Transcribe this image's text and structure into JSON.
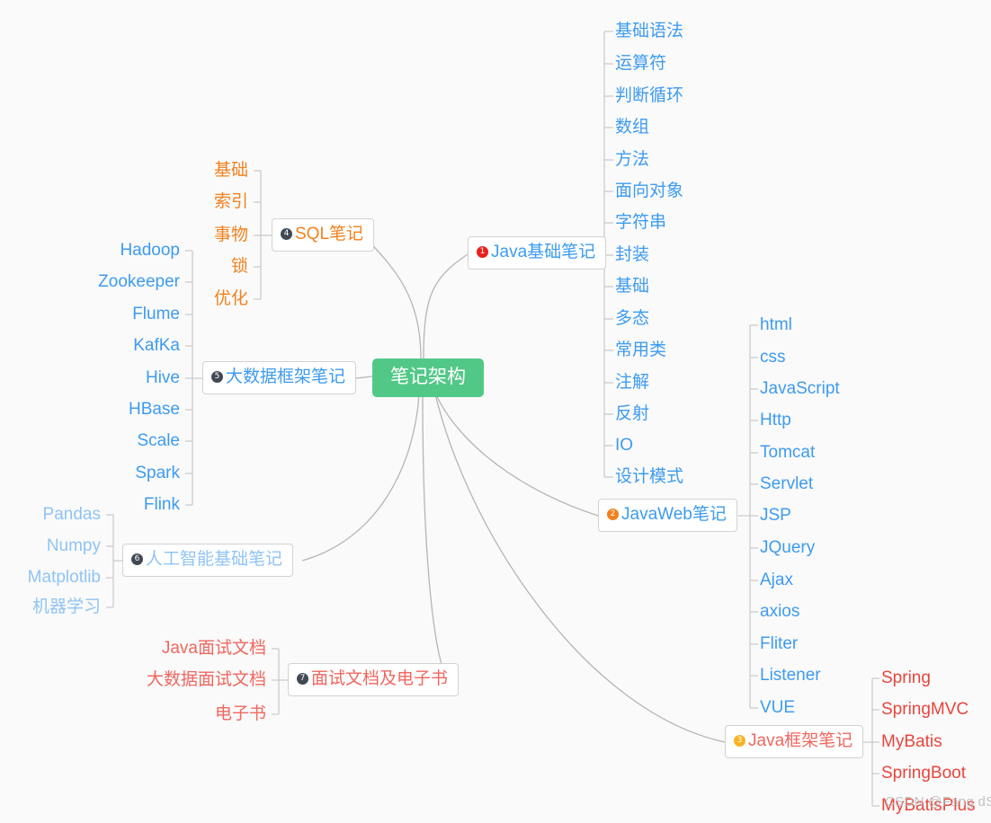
{
  "root": {
    "label": "笔记架构",
    "color": "#52c887"
  },
  "watermark": "CSDN @Fang dS",
  "colors": {
    "blue": "#3d9bf0",
    "blue_light": "#8fc4f5",
    "orange": "#f2811d",
    "red": "#e8453c",
    "salmon": "#f0675f",
    "badge_dark": "#414a54",
    "badge_red": "#e8201c",
    "badge_orange": "#f2811d",
    "badge_yellow": "#f5b324",
    "link": "#b5b5b5"
  },
  "branches": [
    {
      "id": "java-basic",
      "badge": "1",
      "badge_color": "#e8201c",
      "label": "Java基础笔记",
      "text_color": "#3d9bf0",
      "children": [
        "基础语法",
        "运算符",
        "判断循环",
        "数组",
        "方法",
        "面向对象",
        "字符串",
        "封装",
        "基础",
        "多态",
        "常用类",
        "注解",
        "反射",
        "IO",
        "设计模式"
      ],
      "children_color": "#3d9bf0"
    },
    {
      "id": "javaweb",
      "badge": "2",
      "badge_color": "#f2811d",
      "label": "JavaWeb笔记",
      "text_color": "#3d9bf0",
      "children": [
        "html",
        "css",
        "JavaScript",
        "Http",
        "Tomcat",
        "Servlet",
        "JSP",
        "JQuery",
        "Ajax",
        "axios",
        "Fliter",
        "Listener",
        "VUE"
      ],
      "children_color": "#3d9bf0"
    },
    {
      "id": "java-frame",
      "badge": "3",
      "badge_color": "#f5b324",
      "label": "Java框架笔记",
      "text_color": "#f0675f",
      "children": [
        "Spring",
        "SpringMVC",
        "MyBatis",
        "SpringBoot",
        "MyBatisPlus"
      ],
      "children_color": "#e8453c"
    },
    {
      "id": "sql",
      "badge": "4",
      "badge_color": "#414a54",
      "label": "SQL笔记",
      "text_color": "#f2811d",
      "children": [
        "基础",
        "索引",
        "事物",
        "锁",
        "优化"
      ],
      "children_color": "#f2811d"
    },
    {
      "id": "bigdata",
      "badge": "5",
      "badge_color": "#414a54",
      "label": "大数据框架笔记",
      "text_color": "#3d9bf0",
      "children": [
        "Hadoop",
        "Zookeeper",
        "Flume",
        "KafKa",
        "Hive",
        "HBase",
        "Scale",
        "Spark",
        "Flink"
      ],
      "children_color": "#3d9bf0"
    },
    {
      "id": "ai",
      "badge": "6",
      "badge_color": "#414a54",
      "label": "人工智能基础笔记",
      "text_color": "#8fc4f5",
      "children": [
        "Pandas",
        "Numpy",
        "Matplotlib",
        "机器学习"
      ],
      "children_color": "#8fc4f5"
    },
    {
      "id": "interview",
      "badge": "7",
      "badge_color": "#414a54",
      "label": "面试文档及电子书",
      "text_color": "#f0675f",
      "children": [
        "Java面试文档",
        "大数据面试文档",
        "电子书"
      ],
      "children_color": "#f0675f"
    }
  ]
}
